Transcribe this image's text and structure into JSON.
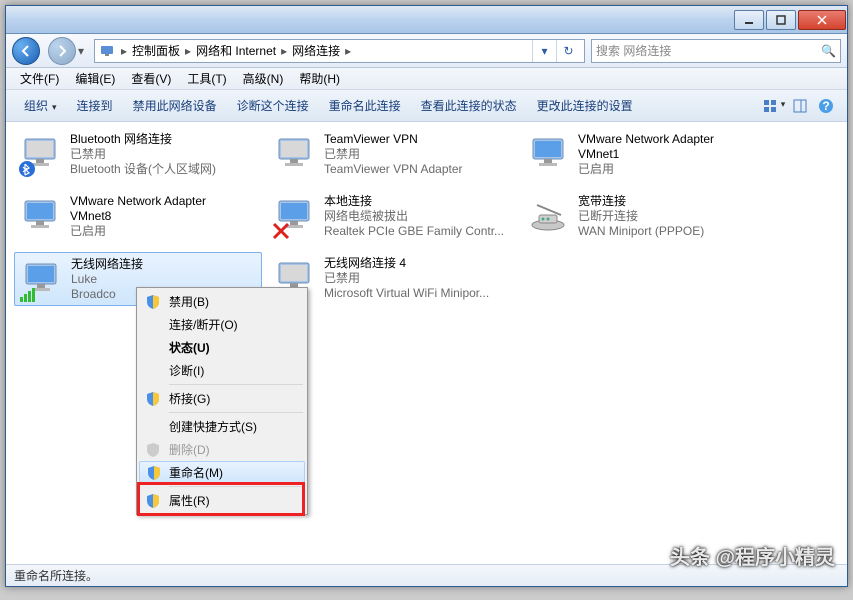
{
  "breadcrumbs": {
    "b1": "控制面板",
    "b2": "网络和 Internet",
    "b3": "网络连接"
  },
  "search": {
    "placeholder": "搜索 网络连接"
  },
  "menu": {
    "file": "文件(F)",
    "edit": "编辑(E)",
    "view": "查看(V)",
    "tools": "工具(T)",
    "advanced": "高级(N)",
    "help": "帮助(H)"
  },
  "toolbar": {
    "organize": "组织",
    "connect": "连接到",
    "disable": "禁用此网络设备",
    "diagnose": "诊断这个连接",
    "rename": "重命名此连接",
    "status": "查看此连接的状态",
    "change": "更改此连接的设置"
  },
  "items": {
    "bt": {
      "l1": "Bluetooth 网络连接",
      "l2": "已禁用",
      "l3": "Bluetooth 设备(个人区域网)"
    },
    "tv": {
      "l1": "TeamViewer VPN",
      "l2": "已禁用",
      "l3": "TeamViewer VPN Adapter"
    },
    "vm1": {
      "l1": "VMware Network Adapter",
      "l1b": "VMnet1",
      "l2": "已启用"
    },
    "vm8": {
      "l1": "VMware Network Adapter",
      "l1b": "VMnet8",
      "l2": "已启用"
    },
    "local": {
      "l1": "本地连接",
      "l2": "网络电缆被拔出",
      "l3": "Realtek PCIe GBE Family Contr..."
    },
    "broadband": {
      "l1": "宽带连接",
      "l2": "已断开连接",
      "l3": "WAN Miniport (PPPOE)"
    },
    "wifi": {
      "l1": "无线网络连接",
      "l2": "Luke",
      "l3": "Broadco"
    },
    "wifi4": {
      "l1": "无线网络连接 4",
      "l2": "已禁用",
      "l3": "Microsoft Virtual WiFi Minipor..."
    }
  },
  "context": {
    "disable": "禁用(B)",
    "connect": "连接/断开(O)",
    "status": "状态(U)",
    "diagnose": "诊断(I)",
    "bridge": "桥接(G)",
    "shortcut": "创建快捷方式(S)",
    "delete": "删除(D)",
    "rename": "重命名(M)",
    "properties": "属性(R)"
  },
  "status": "重命名所连接。",
  "watermark": "头条 @程序小精灵"
}
